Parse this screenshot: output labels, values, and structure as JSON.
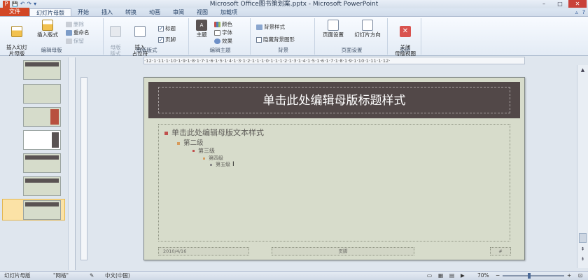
{
  "window": {
    "title": "Microsoft Office图书策划案.pptx - Microsoft PowerPoint",
    "controls": [
      "–",
      "□",
      "✕"
    ]
  },
  "qat": [
    "P",
    "💾",
    "↶",
    "↷",
    "▾"
  ],
  "tabs": {
    "file": "文件",
    "items": [
      "幻灯片母版",
      "开始",
      "插入",
      "转换",
      "动画",
      "审阅",
      "视图",
      "加载项"
    ],
    "active_index": 0,
    "right_icons": [
      "▵",
      "?"
    ]
  },
  "ribbon": {
    "edit_master": {
      "label": "编辑母版",
      "insert_slide_master": "插入幻灯\n片母版",
      "insert_layout": "插入版式",
      "delete": "删除",
      "rename": "重命名",
      "preserve": "保留"
    },
    "master_layout": {
      "label": "母版版式",
      "master_layout_btn": "母版\n版式",
      "insert_placeholder": "插入\n占位符",
      "title_check": "标题",
      "footer_check": "页脚"
    },
    "edit_theme": {
      "label": "编辑主题",
      "theme": "主题",
      "colors": "颜色",
      "fonts": "字体",
      "effects": "效果"
    },
    "background": {
      "label": "背景",
      "bg_styles": "背景样式",
      "hide_bg": "隐藏背景图形"
    },
    "page_setup": {
      "label": "页面设置",
      "page_setup_btn": "页面设置",
      "orientation": "幻灯片方向"
    },
    "close": {
      "label": "关闭",
      "close_master": "关闭\n母版视图"
    }
  },
  "ruler": {
    "horizontal": "·12·1·11·1·10·1·9·1·8·1·7·1·6·1·5·1·4·1·3·1·2·1·1·1·0·1·1·1·2·1·3·1·4·1·5·1·6·1·7·1·8·1·9·1·10·1·11·1·12·"
  },
  "slide": {
    "title": "单击此处编辑母版标题样式",
    "levels": [
      "单击此处编辑母版文本样式",
      "第二级",
      "第三级",
      "第四级",
      "第五级"
    ],
    "footer_date": "2010/4/16",
    "footer_center": "页脚",
    "footer_num": "#",
    "bullet_color": "#c0504d"
  },
  "statusbar": {
    "view": "幻灯片母版",
    "theme": "\"网格\"",
    "language": "中文(中国)",
    "zoom": "70%"
  }
}
